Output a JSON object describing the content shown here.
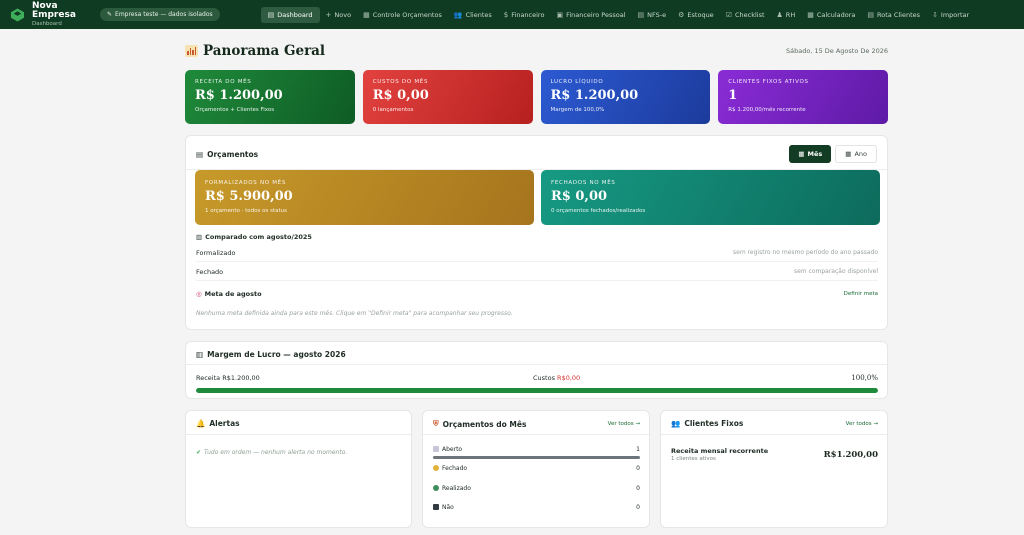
{
  "nav": {
    "brand_name": "Nova Empresa",
    "brand_sub": "Dashboard",
    "company_pill": "Empresa teste — dados isolados",
    "items": [
      {
        "icon": "▤",
        "label": "Dashboard",
        "active": true
      },
      {
        "icon": "+",
        "label": "Novo"
      },
      {
        "icon": "▦",
        "label": "Controle Orçamentos"
      },
      {
        "icon": "👥",
        "label": "Clientes"
      },
      {
        "icon": "$",
        "label": "Financeiro"
      },
      {
        "icon": "▣",
        "label": "Financeiro Pessoal"
      },
      {
        "icon": "▤",
        "label": "NFS-e"
      },
      {
        "icon": "⚙",
        "label": "Estoque"
      },
      {
        "icon": "☑",
        "label": "Checklist"
      },
      {
        "icon": "♟",
        "label": "RH"
      },
      {
        "icon": "▦",
        "label": "Calculadora"
      },
      {
        "icon": "▤",
        "label": "Rota Clientes"
      },
      {
        "icon": "⇩",
        "label": "Importar"
      }
    ]
  },
  "page": {
    "title": "Panorama Geral",
    "date": "Sábado, 15 De Agosto De 2026"
  },
  "kpis": [
    {
      "label": "RECEITA DO MÊS",
      "value": "R$ 1.200,00",
      "sub": "Orçamentos + Clientes Fixos",
      "color": "#1f8a3a"
    },
    {
      "label": "CUSTOS DO MÊS",
      "value": "R$ 0,00",
      "sub": "0 lançamentos",
      "color": "#e2423f"
    },
    {
      "label": "LUCRO LÍQUIDO",
      "value": "R$ 1.200,00",
      "sub": "Margem de 100,0%",
      "color": "#2c5ad2"
    },
    {
      "label": "CLIENTES FIXOS ATIVOS",
      "value": "1",
      "sub": "R$ 1.200,00/mês recorrente",
      "color": "#8a2cd6"
    }
  ],
  "orcamentos": {
    "title": "Orçamentos",
    "toggle_month": "Mês",
    "toggle_year": "Ano",
    "formalizados_label": "FORMALIZADOS NO MÊS",
    "formalizados_value": "R$ 5.900,00",
    "formalizados_sub": "1 orçamento · todos os status",
    "fechados_label": "FECHADOS NO MÊS",
    "fechados_value": "R$ 0,00",
    "fechados_sub": "0 orçamentos fechados/realizados",
    "compare_title": "Comparado com agosto/2025",
    "compare_rows": [
      {
        "left": "Formalizado",
        "right": "sem registro no mesmo período do ano passado"
      },
      {
        "left": "Fechado",
        "right": "sem comparação disponível"
      }
    ],
    "meta_title": "Meta de agosto",
    "meta_link": "Definir meta",
    "meta_note": "Nenhuma meta definida ainda para este mês. Clique em \"Definir meta\" para acompanhar seu progresso."
  },
  "margem": {
    "title": "Margem de Lucro — agosto 2026",
    "receita_label": "Receita",
    "receita_value": "R$1.200,00",
    "custos_label": "Custos",
    "custos_value": "R$0,00",
    "percent": "100,0%",
    "fill": 1.0
  },
  "alertas": {
    "title": "Alertas",
    "note": "Tudo em ordem — nenhum alerta no momento."
  },
  "orcamentos_mes": {
    "title": "Orçamentos do Mês",
    "link": "Ver todos →",
    "rows": [
      {
        "label": "Aberto",
        "count": "1",
        "color": "#c9c4d8",
        "fill": 1.0
      },
      {
        "label": "Fechado",
        "count": "0",
        "color": "#e3b23c"
      },
      {
        "label": "Realizado",
        "count": "0",
        "color": "#3f8f5a"
      },
      {
        "label": "Não",
        "count": "0",
        "color": "#333a40"
      }
    ]
  },
  "clientes_fixos": {
    "title": "Clientes Fixos",
    "link": "Ver todos →",
    "label": "Receita mensal recorrente",
    "sub": "1 clientes ativos",
    "value": "R$1.200,00"
  }
}
